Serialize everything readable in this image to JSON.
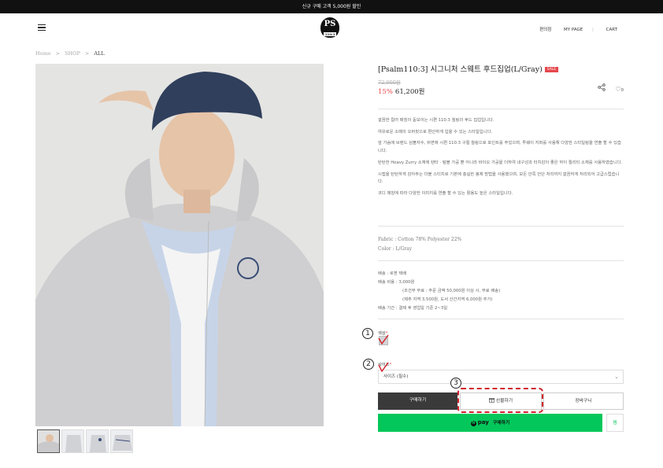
{
  "topbar": {
    "text": "신규 구매 고객 5,000원 할인"
  },
  "header": {
    "logo_text": "PS",
    "logo_sub": "110:3",
    "nav": [
      "편의점",
      "MY PAGE",
      "CART"
    ]
  },
  "breadcrumb": [
    "Home",
    "SHOP",
    "ALL"
  ],
  "product": {
    "title": "[Psalm110:3] 시그니처 스웨트 후드집업(L/Gray)",
    "badge": "SALE",
    "old_price": "72,000원",
    "discount": "15%",
    "price": "61,200원",
    "like_count": "0",
    "description": [
      "깔끔한 컬러 매칭이 돋보이는 시편 110:3 월링의 후드 집업입니다.",
      "여유로운 소매의 오버핏으로 편안하게 입을 수 있는 스타일입니다.",
      "앞 가슴에 브랜드 심볼자수, 뒤면에 시편 110:3 구절 월링으로 포인트를 주었으며, 투웨이 지퍼를 사용해 다양한 스타일링을 연출 할 수 있습니다.",
      "탄탄한 Heavy Zurry 소재에 텐타 · 텀블 가공 뿐 아니라 바이오 가공을 더하여 내구성과 터치감이 좋은 하이 퀄리티 소재를 사용하였습니다.",
      "시접을 탄탄하게 감아주는 더블 스티치로 기본에 충실한 봉제 방법을 사용했으며, 모든 안쪽 안단 처리까지 깔끔하게 처리되어 고급스럽습니다.",
      "코디 매칭에 따라 다양한 이미지를 연출 할 수 있는 활용도 높은 스타일입니다."
    ],
    "fabric": "Fabric : Cotton 78% Polyester 22%",
    "color": "Color : L/Gray",
    "shipping": {
      "method": "배송 : 로젠 택배",
      "fee": "배송 비용 : 3,000원",
      "fee_note1": "(조건부 무료 : 주문 금액 50,000원 이상 시, 무료 배송)",
      "fee_note2": "(제주 지역 3,500원, 도서 산간지역 6,000원 추가)",
      "period": "배송 기간 : 결제 후 영업일 기준 2~3일"
    }
  },
  "options": {
    "color_label": "색상",
    "size_label": "사이즈",
    "required_mark": "*",
    "size_placeholder": "사이즈 (필수)"
  },
  "buttons": {
    "buy": "구매하기",
    "gift": "선물하기",
    "cart": "장바구니",
    "npay_brand": "pay",
    "npay_label": "구매하기",
    "zzim": "찜"
  },
  "annotations": [
    "1",
    "2",
    "3"
  ],
  "colors": {
    "accent": "#e5484d",
    "npay": "#03c75a",
    "annotation": "#d0202a"
  }
}
